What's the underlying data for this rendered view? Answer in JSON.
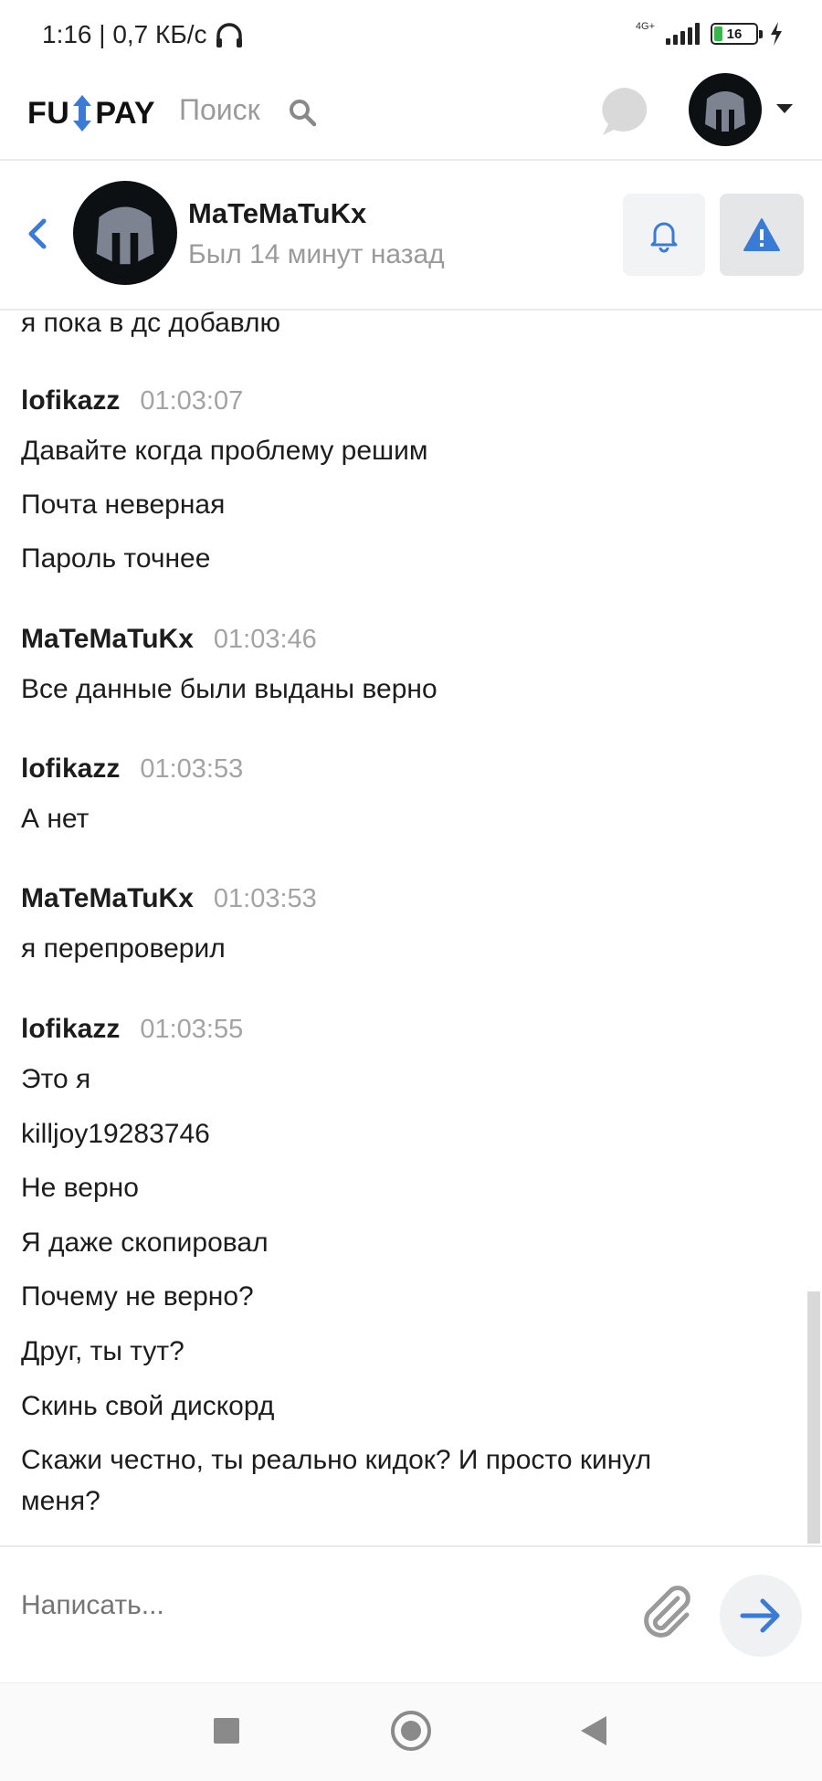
{
  "status_bar": {
    "time_speed": "1:16 | 0,7 КБ/с",
    "network": "4G+",
    "battery": "16"
  },
  "site_header": {
    "logo_left": "FU",
    "logo_right": "PAY",
    "search_label": "Поиск"
  },
  "chat_header": {
    "name": "MaTeMaTuKx",
    "status": "Был 14 минут назад"
  },
  "messages": {
    "prev_line": "я пока в дс добавлю",
    "groups": [
      {
        "author": "lofikazz",
        "time": "01:03:07",
        "lines": [
          "Давайте когда проблему решим",
          "Почта неверная",
          "Пароль точнее"
        ]
      },
      {
        "author": "MaTeMaTuKx",
        "time": "01:03:46",
        "lines": [
          "Все данные были выданы верно"
        ]
      },
      {
        "author": "lofikazz",
        "time": "01:03:53",
        "lines": [
          "А нет"
        ]
      },
      {
        "author": "MaTeMaTuKx",
        "time": "01:03:53",
        "lines": [
          "я перепроверил"
        ]
      },
      {
        "author": "lofikazz",
        "time": "01:03:55",
        "lines": [
          "Это я",
          "killjoy19283746",
          "Не верно",
          "Я даже скопировал",
          "Почему не верно?",
          "Друг, ты тут?",
          "Скинь свой дискорд",
          "Скажи честно, ты реально кидок? И просто кинул",
          "меня?"
        ]
      }
    ]
  },
  "composer": {
    "placeholder": "Написать..."
  },
  "colors": {
    "accent_blue": "#3a7bd5",
    "muted_gray": "#9a9a9a",
    "battery_green": "#35b84a"
  }
}
